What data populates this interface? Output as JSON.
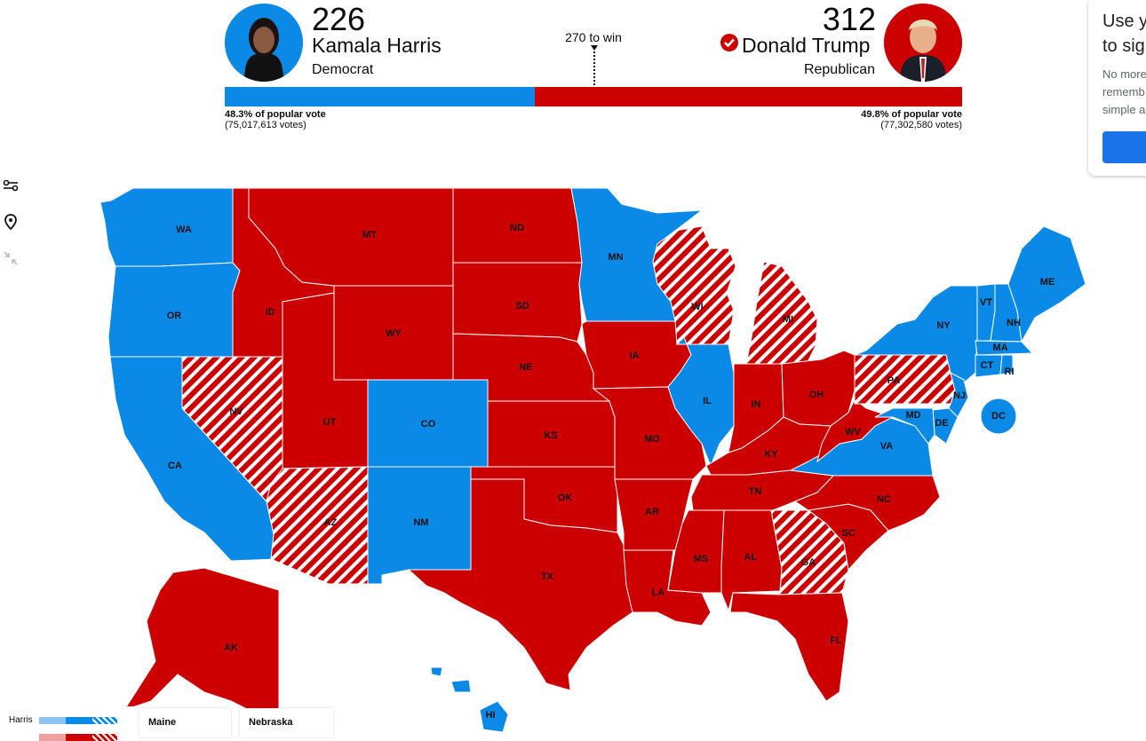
{
  "header": {
    "harris": {
      "ev": "226",
      "name": "Kamala Harris",
      "party": "Democrat",
      "popular_pct": "48.3% of popular vote",
      "popular_votes": "(75,017,613 votes)"
    },
    "trump": {
      "ev": "312",
      "name": "Donald Trump",
      "party": "Republican",
      "popular_pct": "49.8% of popular vote",
      "popular_votes": "(77,302,580 votes)",
      "winner": true
    },
    "threshold": "270 to win",
    "bar": {
      "total": 538,
      "harris_ev": 226,
      "trump_ev": 312
    }
  },
  "colors": {
    "dem": "#0a8ae6",
    "rep": "#cc0000",
    "flip_stripe": "#ffffff"
  },
  "tools": [
    {
      "name": "filter-settings-icon"
    },
    {
      "name": "location-pin-icon"
    },
    {
      "name": "collapse-icon"
    }
  ],
  "popup": {
    "title": "Use y\nto sig",
    "body": "No more\nrememb\nsimple a"
  },
  "map": {
    "states": {
      "WA": "dem",
      "OR": "dem",
      "CA": "dem",
      "NV": "rep-flip",
      "ID": "rep",
      "MT": "rep",
      "WY": "rep",
      "UT": "rep",
      "CO": "dem",
      "AZ": "rep-flip",
      "NM": "dem",
      "ND": "rep",
      "SD": "rep",
      "NE": "rep",
      "KS": "rep",
      "OK": "rep",
      "TX": "rep",
      "MN": "dem",
      "IA": "rep",
      "MO": "rep",
      "AR": "rep",
      "LA": "rep",
      "WI": "rep-flip",
      "IL": "dem",
      "MI": "rep-flip",
      "IN": "rep",
      "OH": "rep",
      "KY": "rep",
      "TN": "rep",
      "MS": "rep",
      "AL": "rep",
      "GA": "rep-flip",
      "FL": "rep",
      "SC": "rep",
      "NC": "rep",
      "VA": "dem",
      "WV": "rep",
      "PA": "rep-flip",
      "NY": "dem",
      "VT": "dem",
      "NH": "dem",
      "ME": "dem",
      "MA": "dem",
      "CT": "dem",
      "RI": "dem",
      "NJ": "dem",
      "DE": "dem",
      "MD": "dem",
      "DC": "dem",
      "AK": "rep",
      "HI": "dem"
    },
    "labels": {
      "WA": "WA",
      "OR": "OR",
      "CA": "CA",
      "NV": "NV",
      "ID": "ID",
      "MT": "MT",
      "WY": "WY",
      "UT": "UT",
      "CO": "CO",
      "AZ": "AZ",
      "NM": "NM",
      "ND": "ND",
      "SD": "SD",
      "NE": "NE",
      "KS": "KS",
      "OK": "OK",
      "TX": "TX",
      "MN": "MN",
      "IA": "IA",
      "MO": "MO",
      "AR": "AR",
      "LA": "LA",
      "WI": "WI",
      "IL": "IL",
      "MI": "MI",
      "IN": "IN",
      "OH": "OH",
      "KY": "KY",
      "TN": "TN",
      "MS": "MS",
      "AL": "AL",
      "GA": "GA",
      "FL": "FL",
      "SC": "SC",
      "NC": "NC",
      "VA": "VA",
      "WV": "WV",
      "PA": "PA",
      "NY": "NY",
      "VT": "VT",
      "NH": "NH",
      "ME": "ME",
      "MA": "MA",
      "CT": "CT",
      "RI": "RI",
      "NJ": "NJ",
      "DE": "DE",
      "MD": "MD",
      "DC": "DC",
      "AK": "AK",
      "HI": "HI"
    }
  },
  "legend": {
    "harris_label": "Harris"
  },
  "split_tabs": {
    "maine": "Maine",
    "nebraska": "Nebraska"
  }
}
